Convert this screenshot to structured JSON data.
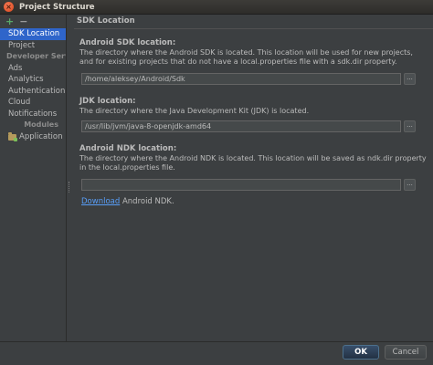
{
  "window": {
    "title": "Project Structure",
    "close_glyph": "×"
  },
  "sidebar": {
    "toolbar": {
      "add_glyph": "+",
      "remove_glyph": "−"
    },
    "items": [
      {
        "label": "SDK Location",
        "selected": true
      },
      {
        "label": "Project"
      }
    ],
    "developer_services_header": "Developer Services",
    "services": [
      {
        "label": "Ads"
      },
      {
        "label": "Analytics"
      },
      {
        "label": "Authentication"
      },
      {
        "label": "Cloud"
      },
      {
        "label": "Notifications"
      }
    ],
    "modules_header": "Modules",
    "modules": [
      {
        "label": "Application",
        "icon": "module-folder-icon"
      }
    ]
  },
  "content": {
    "title": "SDK Location",
    "android_sdk": {
      "label": "Android SDK location:",
      "description": "The directory where the Android SDK is located. This location will be used for new projects, and for existing projects that do not have a local.properties file with a sdk.dir property.",
      "value": "/home/aleksey/Android/Sdk",
      "browse_label": "..."
    },
    "jdk": {
      "label": "JDK location:",
      "description": "The directory where the Java Development Kit (JDK) is located.",
      "value": "/usr/lib/jvm/java-8-openjdk-amd64",
      "browse_label": "..."
    },
    "android_ndk": {
      "label": "Android NDK location:",
      "description": "The directory where the Android NDK is located. This location will be saved as ndk.dir property in the local.properties file.",
      "value": "",
      "browse_label": "..."
    },
    "download": {
      "link_text": "Download",
      "suffix": " Android NDK."
    }
  },
  "footer": {
    "ok_label": "OK",
    "cancel_label": "Cancel"
  },
  "colors": {
    "selection": "#2f65ca",
    "link": "#589df6",
    "background": "#3c3f41"
  }
}
